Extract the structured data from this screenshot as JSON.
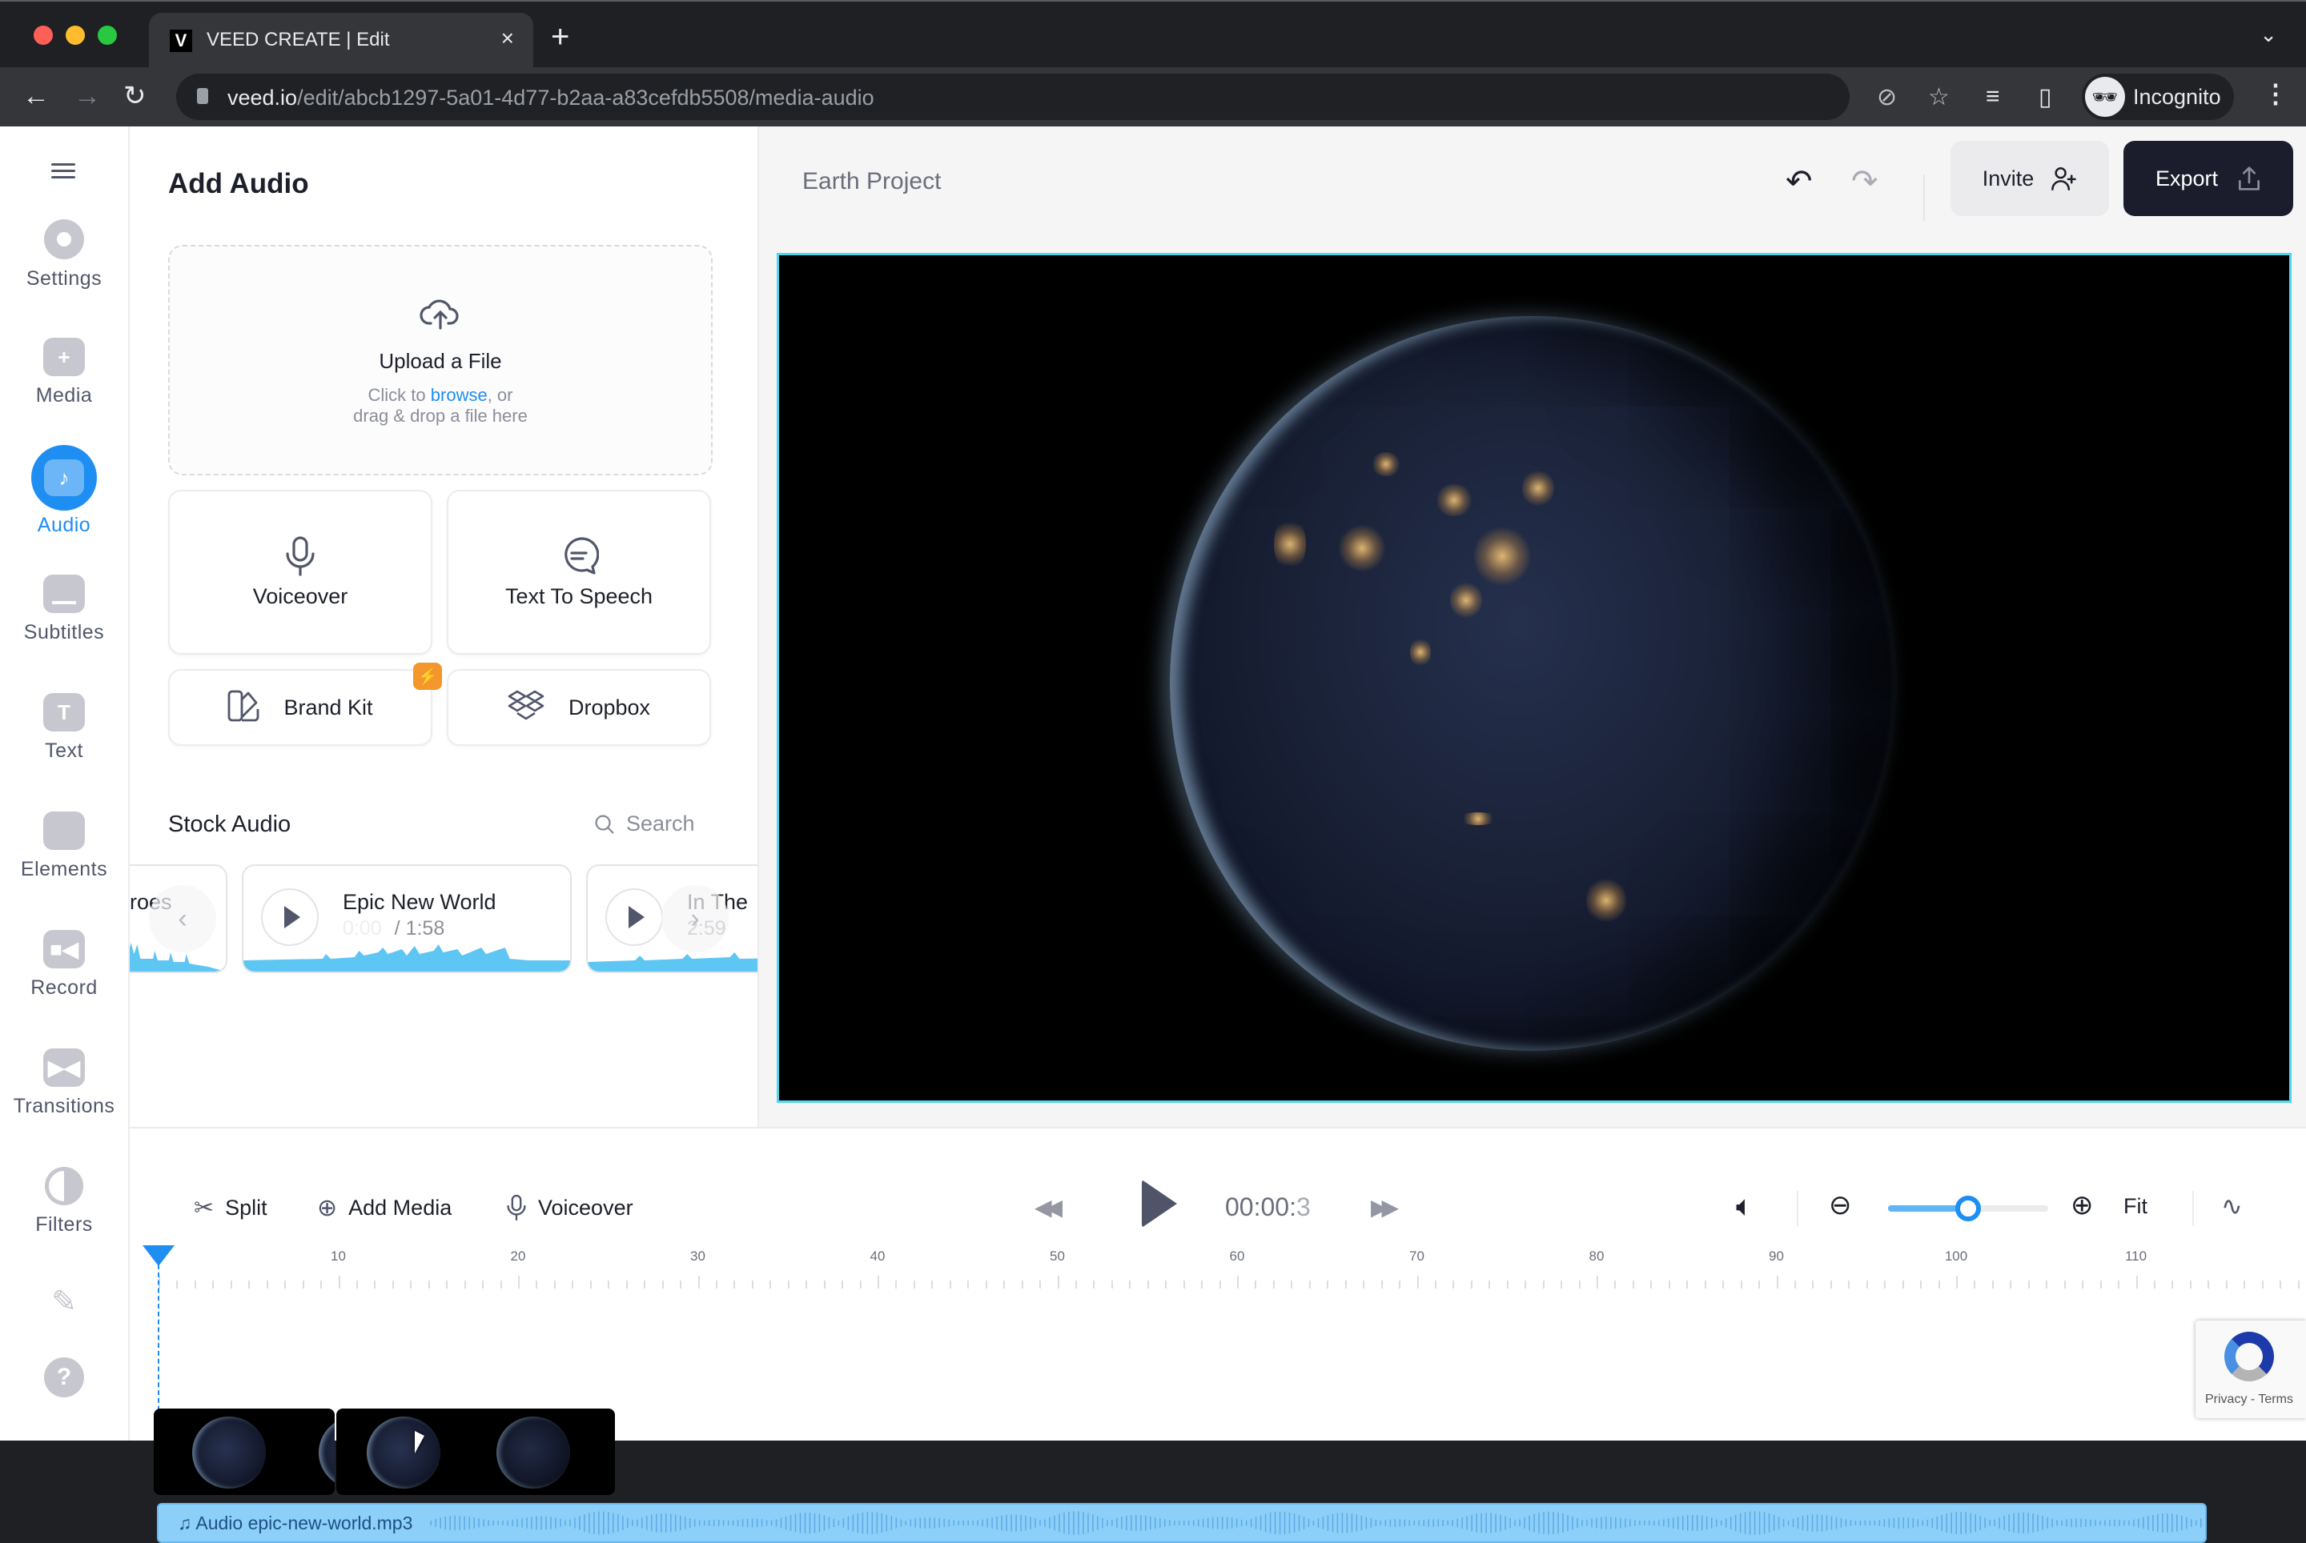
{
  "browser": {
    "tab_title": "VEED CREATE | Edit",
    "tab_favicon": "V",
    "tab_close": "×",
    "new_tab": "+",
    "url_host": "veed.io",
    "url_path": "/edit/abcb1297-5a01-4d77-b2aa-a83cefdb5508/media-audio",
    "profile_label": "Incognito"
  },
  "sidebar": {
    "items": [
      {
        "label": "Settings",
        "icon": "settings-icon"
      },
      {
        "label": "Media",
        "icon": "plus-icon",
        "glyph": "+"
      },
      {
        "label": "Audio",
        "icon": "music-note-icon",
        "glyph": "♪",
        "active": true
      },
      {
        "label": "Subtitles",
        "icon": "subtitles-icon"
      },
      {
        "label": "Text",
        "icon": "text-icon",
        "glyph": "T"
      },
      {
        "label": "Elements",
        "icon": "sticker-icon"
      },
      {
        "label": "Record",
        "icon": "camera-icon"
      },
      {
        "label": "Transitions",
        "icon": "transition-icon"
      },
      {
        "label": "Filters",
        "icon": "filter-icon"
      }
    ],
    "extra_icons": [
      "pencil-icon",
      "help-icon"
    ],
    "help_glyph": "?",
    "pencil_glyph": "✎"
  },
  "panel": {
    "title": "Add Audio",
    "upload": {
      "title": "Upload a File",
      "sub_prefix": "Click to ",
      "sub_link": "browse",
      "sub_suffix": ", or",
      "sub_line2": "drag & drop a file here"
    },
    "cards": [
      {
        "label": "Voiceover",
        "icon": "microphone-icon"
      },
      {
        "label": "Text To Speech",
        "icon": "speech-bubble-icon"
      },
      {
        "label": "Brand Kit",
        "icon": "brand-kit-icon",
        "badge": "⚡"
      },
      {
        "label": "Dropbox",
        "icon": "dropbox-icon"
      }
    ],
    "stock_title": "Stock Audio",
    "search_label": "Search",
    "tracks": [
      {
        "name": "roes",
        "duration": ""
      },
      {
        "name": "Epic New World",
        "current": "0:00",
        "duration": "1:58"
      },
      {
        "name": "In The",
        "duration": "2:59"
      }
    ],
    "prev_arrow": "‹",
    "next_arrow": "›"
  },
  "header": {
    "project_name": "Earth Project",
    "undo_glyph": "↶",
    "redo_glyph": "↷",
    "invite_label": "Invite",
    "export_label": "Export"
  },
  "timeline": {
    "split_label": "Split",
    "add_media_label": "Add Media",
    "voiceover_label": "Voiceover",
    "timecode_main": "00:00:",
    "timecode_frac": "3",
    "fit_label": "Fit",
    "zoom_level": 0.5,
    "ruler_labels": [
      "10",
      "20",
      "30",
      "40",
      "50",
      "60",
      "70",
      "80",
      "90",
      "100",
      "110"
    ],
    "audio_clip_label": "Audio epic-new-world.mp3"
  },
  "recaptcha": {
    "text": "Privacy - Terms"
  },
  "colors": {
    "accent": "#1e8ef2",
    "export_bg": "#1b1d2c",
    "badge": "#f3962b",
    "audio_clip": "#8ccff9",
    "preview_border": "#4fd6ea"
  }
}
